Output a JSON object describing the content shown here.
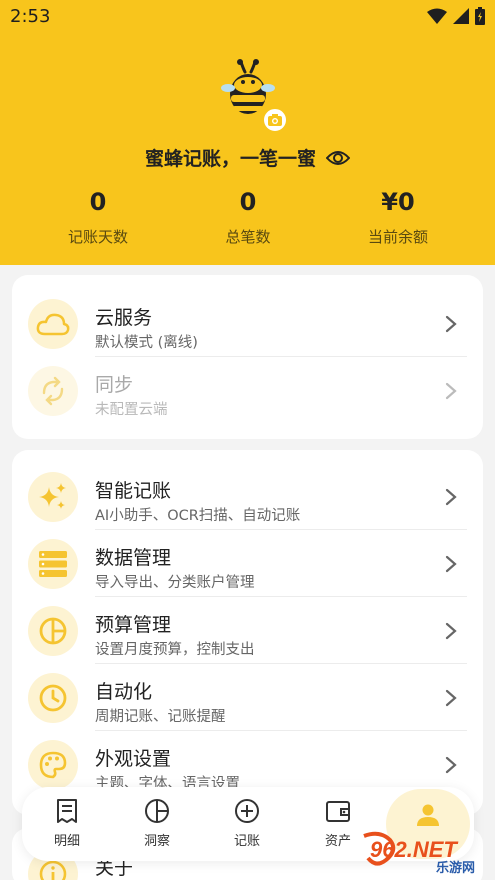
{
  "status_bar": {
    "time": "2:53"
  },
  "profile": {
    "slogan": "蜜蜂记账，一笔一蜜"
  },
  "stats": [
    {
      "value": "0",
      "label": "记账天数"
    },
    {
      "value": "0",
      "label": "总笔数"
    },
    {
      "value": "¥0",
      "label": "当前余额"
    }
  ],
  "cloud_card": {
    "items": [
      {
        "title": "云服务",
        "subtitle": "默认模式 (离线)"
      },
      {
        "title": "同步",
        "subtitle": "未配置云端"
      }
    ]
  },
  "feature_card": {
    "items": [
      {
        "title": "智能记账",
        "subtitle": "AI小助手、OCR扫描、自动记账"
      },
      {
        "title": "数据管理",
        "subtitle": "导入导出、分类账户管理"
      },
      {
        "title": "预算管理",
        "subtitle": "设置月度预算，控制支出"
      },
      {
        "title": "自动化",
        "subtitle": "周期记账、记账提醒"
      },
      {
        "title": "外观设置",
        "subtitle": "主题、字体、语言设置"
      }
    ]
  },
  "about_card": {
    "title": "关于"
  },
  "bottom_nav": {
    "items": [
      {
        "label": "明细"
      },
      {
        "label": "洞察"
      },
      {
        "label": "记账"
      },
      {
        "label": "资产"
      },
      {
        "label": "我的"
      }
    ],
    "active_index": 4
  },
  "watermark": {
    "brand": "962.NET",
    "sub": "乐游网"
  },
  "colors": {
    "brand_yellow": "#f8c51c",
    "icon_yellow": "#f5c431",
    "icon_bg": "#fdf3d2"
  }
}
